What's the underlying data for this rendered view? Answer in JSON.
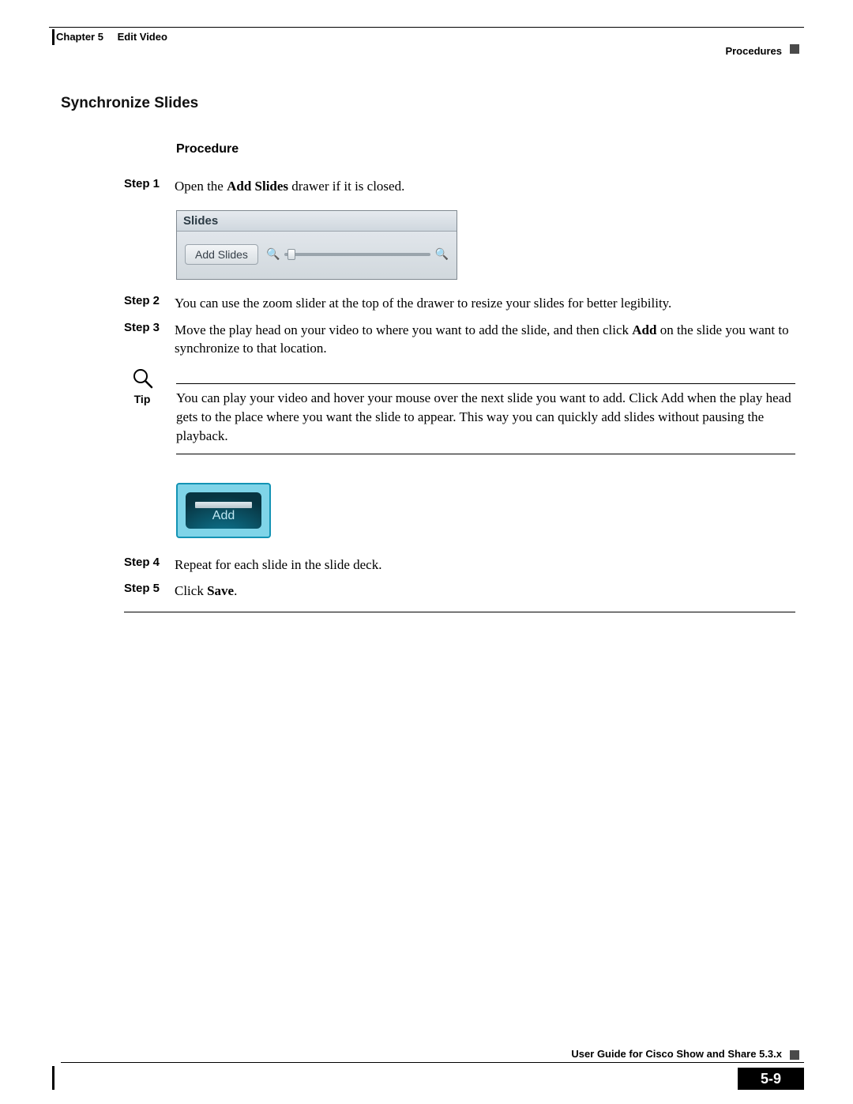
{
  "header": {
    "chapter_label": "Chapter 5",
    "chapter_title": "Edit Video",
    "right_label": "Procedures"
  },
  "section_title": "Synchronize Slides",
  "procedure_heading": "Procedure",
  "steps": {
    "s1_label": "Step 1",
    "s1_a": "Open the ",
    "s1_b": "Add Slides",
    "s1_c": " drawer if it is closed.",
    "s2_label": "Step 2",
    "s2": "You can use the zoom slider at the top of the drawer to resize your slides for better legibility.",
    "s3_label": "Step 3",
    "s3_a": "Move the play head on your video to where you want to add the slide, and then click ",
    "s3_b": "Add",
    "s3_c": " on the slide you want to synchronize to that location.",
    "s4_label": "Step 4",
    "s4": "Repeat for each slide in the slide deck.",
    "s5_label": "Step 5",
    "s5_a": "Click ",
    "s5_b": "Save",
    "s5_c": "."
  },
  "slides_panel": {
    "tab": "Slides",
    "button": "Add Slides"
  },
  "tip": {
    "label": "Tip",
    "text": "You can play your video and hover your mouse over the next slide you want to add. Click Add when the play head gets to the place where you want the slide to appear. This way you can quickly add slides without pausing the playback."
  },
  "add_thumb_label": "Add",
  "footer": {
    "guide": "User Guide for Cisco Show and Share 5.3.x",
    "page_number": "5-9"
  }
}
